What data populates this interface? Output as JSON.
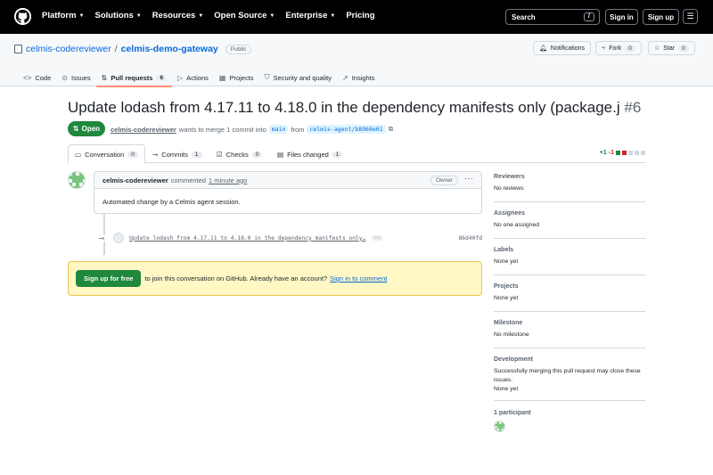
{
  "nav": {
    "links": [
      "Platform",
      "Solutions",
      "Resources",
      "Open Source",
      "Enterprise",
      "Pricing"
    ],
    "search_label": "Search",
    "search_key": "/",
    "signin": "Sign in",
    "signup": "Sign up"
  },
  "repo": {
    "owner": "celmis-codereviewer",
    "separator": "/",
    "name": "celmis-demo-gateway",
    "visibility": "Public",
    "notifications": "Notifications",
    "fork": "Fork",
    "fork_count": "0",
    "star": "Star",
    "star_count": "0"
  },
  "tabs": [
    {
      "label": "Code",
      "icon": "code-icon"
    },
    {
      "label": "Issues",
      "icon": "issue-icon"
    },
    {
      "label": "Pull requests",
      "icon": "pull-request-icon",
      "count": "6"
    },
    {
      "label": "Actions",
      "icon": "play-icon"
    },
    {
      "label": "Projects",
      "icon": "table-icon"
    },
    {
      "label": "Security and quality",
      "icon": "shield-icon"
    },
    {
      "label": "Insights",
      "icon": "graph-icon"
    }
  ],
  "pr": {
    "title": "Update lodash from 4.17.11 to 4.18.0 in the dependency manifests only (package.j",
    "number": "#6",
    "state": "Open",
    "author": "celmis-codereviewer",
    "merge_text": "wants to merge 1 commit into",
    "base_branch": "main",
    "from_text": "from",
    "head_branch": "celmis-agent/b8960e01"
  },
  "pr_tabs": [
    {
      "label": "Conversation",
      "count": "0"
    },
    {
      "label": "Commits",
      "count": "1"
    },
    {
      "label": "Checks",
      "count": "0"
    },
    {
      "label": "Files changed",
      "count": "1"
    }
  ],
  "diffstat": {
    "additions": "+1",
    "deletions": "-1"
  },
  "comment": {
    "author": "celmis-codereviewer",
    "verb": "commented",
    "time": "1 minute ago",
    "role": "Owner",
    "body": "Automated change by a Celmis agent session."
  },
  "commit": {
    "message": "Update lodash from 4.17.11 to 4.18.0 in the dependency manifests only…",
    "more": "···",
    "sha": "86d40fd"
  },
  "banner": {
    "button": "Sign up for free",
    "text": "to join this conversation on GitHub. Already have an account?",
    "link": "Sign in to comment"
  },
  "sidebar": {
    "reviewers_title": "Reviewers",
    "reviewers_val": "No reviews",
    "assignees_title": "Assignees",
    "assignees_val": "No one assigned",
    "labels_title": "Labels",
    "labels_val": "None yet",
    "projects_title": "Projects",
    "projects_val": "None yet",
    "milestone_title": "Milestone",
    "milestone_val": "No milestone",
    "development_title": "Development",
    "development_val": "Successfully merging this pull request may close these issues.",
    "development_val2": "None yet",
    "participants_title": "1 participant"
  },
  "colors": {
    "accent": "#0969da",
    "open_green": "#1f883d",
    "active_tab": "#fd8c73",
    "banner_bg": "#fff8c5"
  }
}
